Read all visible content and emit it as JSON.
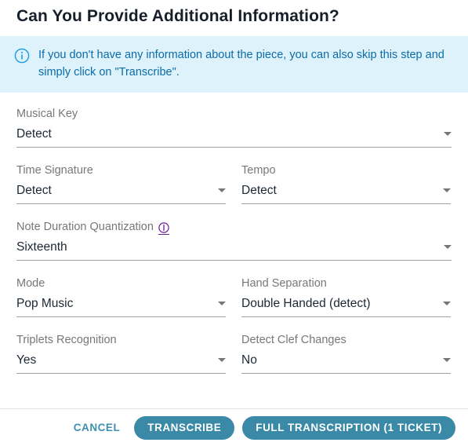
{
  "dialog": {
    "title": "Can You Provide Additional Information?",
    "banner": {
      "icon": "info-circle-icon",
      "text": "If you don't have any information about the piece, you can also skip this step and simply click on \"Transcribe\"."
    },
    "fields": [
      {
        "name": "musical-key",
        "label": "Musical Key",
        "value": "Detect",
        "help_icon": null,
        "width": "full"
      },
      {
        "name": "time-signature",
        "label": "Time Signature",
        "value": "Detect",
        "help_icon": null,
        "width": "half"
      },
      {
        "name": "tempo",
        "label": "Tempo",
        "value": "Detect",
        "help_icon": null,
        "width": "half"
      },
      {
        "name": "note-duration-quantization",
        "label": "Note Duration Quantization",
        "value": "Sixteenth",
        "help_icon": "info-circle-icon",
        "width": "full"
      },
      {
        "name": "mode",
        "label": "Mode",
        "value": "Pop Music",
        "help_icon": null,
        "width": "half"
      },
      {
        "name": "hand-separation",
        "label": "Hand Separation",
        "value": "Double Handed (detect)",
        "help_icon": null,
        "width": "half"
      },
      {
        "name": "triplets-recognition",
        "label": "Triplets Recognition",
        "value": "Yes",
        "help_icon": null,
        "width": "half"
      },
      {
        "name": "detect-clef-changes",
        "label": "Detect Clef Changes",
        "value": "No",
        "help_icon": null,
        "width": "half"
      }
    ],
    "footer": {
      "cancel_label": "CANCEL",
      "transcribe_label": "TRANSCRIBE",
      "full_transcription_label": "FULL TRANSCRIPTION (1 TICKET)"
    }
  },
  "colors": {
    "banner_background": "#ddf2fb",
    "banner_text": "#0c6ca8",
    "accent_teal": "#3a89a6",
    "help_icon_purple": "#6a1b9a",
    "label_gray": "#777777",
    "value_dark": "#1b2733"
  }
}
